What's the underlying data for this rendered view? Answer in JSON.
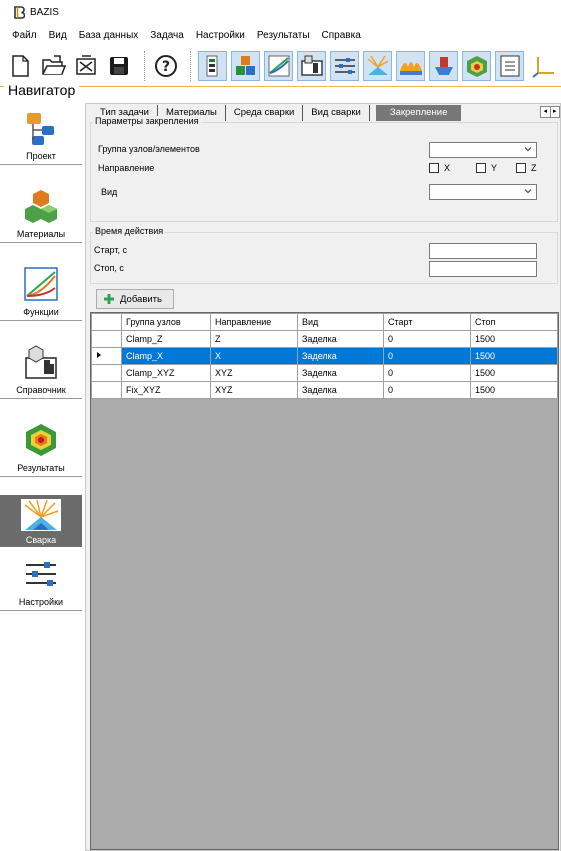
{
  "window": {
    "title": "BAZIS"
  },
  "menu": [
    "Файл",
    "Вид",
    "База данных",
    "Задача",
    "Настройки",
    "Результаты",
    "Справка"
  ],
  "toolbar": [
    {
      "icon": "new-file-icon"
    },
    {
      "icon": "open-folder-icon"
    },
    {
      "icon": "close-file-icon"
    },
    {
      "icon": "save-icon"
    },
    {
      "icon": "help-icon"
    },
    {
      "icon": "task-icon"
    },
    {
      "icon": "materials-icon"
    },
    {
      "icon": "chart-icon"
    },
    {
      "icon": "reference-icon"
    },
    {
      "icon": "settings-sliders-icon"
    },
    {
      "icon": "welding-icon"
    },
    {
      "icon": "heat-icon"
    },
    {
      "icon": "fixture-icon"
    },
    {
      "icon": "results-icon"
    },
    {
      "icon": "list-icon"
    },
    {
      "icon": "axes-icon"
    }
  ],
  "navigator": {
    "title": "Навигатор",
    "items": [
      {
        "label": "Проект",
        "icon": "project-tree-icon"
      },
      {
        "label": "Материалы",
        "icon": "materials-cubes-icon"
      },
      {
        "label": "Функции",
        "icon": "functions-chart-icon"
      },
      {
        "label": "Справочник",
        "icon": "reference-book-icon"
      },
      {
        "label": "Результаты",
        "icon": "results-cube-icon"
      },
      {
        "label": "Сварка",
        "icon": "welding-sparks-icon",
        "active": true
      },
      {
        "label": "Настройки",
        "icon": "settings-sliders-icon"
      }
    ]
  },
  "tabs": [
    "Тип задачи",
    "Материалы",
    "Среда сварки",
    "Вид сварки",
    "Закрепление"
  ],
  "active_tab": "Закрепление",
  "params": {
    "title": "Параметры закрепления",
    "group_label": "Группа узлов/элементов",
    "group_value": "",
    "direction_label": "Направление",
    "checks": [
      "X",
      "Y",
      "Z"
    ],
    "type_label": "Вид",
    "type_value": ""
  },
  "time": {
    "title": "Время действия",
    "start_label": "Старт, с",
    "start_value": "",
    "stop_label": "Стоп, с",
    "stop_value": ""
  },
  "add_button": "Добавить",
  "table": {
    "columns": [
      "Группа узлов",
      "Направление",
      "Вид",
      "Старт",
      "Стоп"
    ],
    "rows": [
      [
        "Clamp_Z",
        "Z",
        "Заделка",
        "0",
        "1500"
      ],
      [
        "Clamp_X",
        "X",
        "Заделка",
        "0",
        "1500"
      ],
      [
        "Clamp_XYZ",
        "XYZ",
        "Заделка",
        "0",
        "1500"
      ],
      [
        "Fix_XYZ",
        "XYZ",
        "Заделка",
        "0",
        "1500"
      ]
    ],
    "selected_row": 1
  }
}
